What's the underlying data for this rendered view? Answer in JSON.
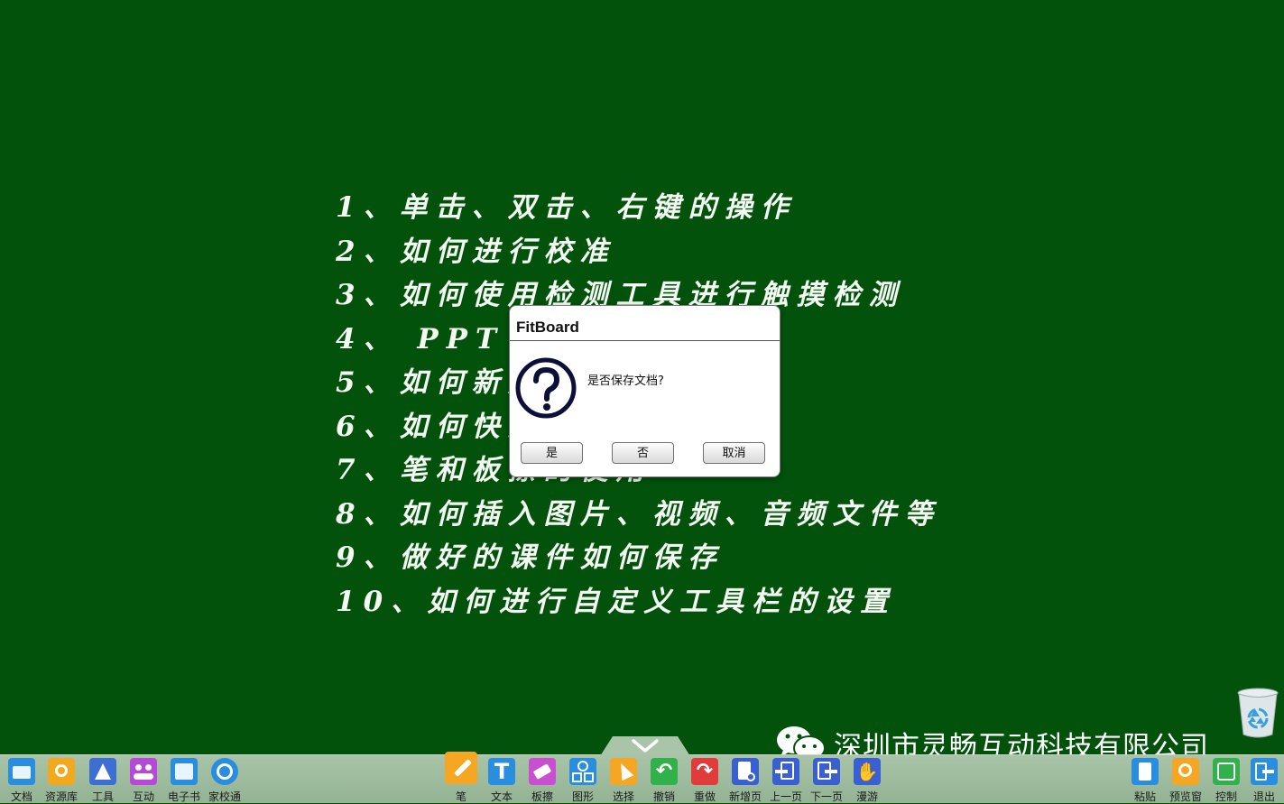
{
  "lesson_items": [
    "1、单击、双击、右键的操作",
    "2、如何进行校准",
    "3、如何使用检测工具进行触摸检测",
    "4、 PPT 模式的使用",
    "5、如何新建页面",
    "6、如何快速清屏",
    "7、笔和板擦的使用",
    "8、如何插入图片、视频、音频文件等",
    "9、做好的课件如何保存",
    "10、如何进行自定义工具栏的设置"
  ],
  "dialog": {
    "title": "FitBoard",
    "message": "是否保存文档?",
    "yes_label": "是",
    "no_label": "否",
    "cancel_label": "取消"
  },
  "watermark": {
    "text": "深圳市灵畅互动科技有限公司"
  },
  "toolbar": {
    "left": [
      {
        "label": "文档",
        "icon": "folder-icon",
        "color": "#2a8ee0"
      },
      {
        "label": "资源库",
        "icon": "resource-library-icon",
        "color": "#f2a91e"
      },
      {
        "label": "工具",
        "icon": "ruler-triangle-icon",
        "color": "#3c6fd1"
      },
      {
        "label": "互动",
        "icon": "people-icon",
        "color": "#b64ad8"
      },
      {
        "label": "电子书",
        "icon": "book-icon",
        "color": "#2a8ee0"
      },
      {
        "label": "家校通",
        "icon": "home-school-icon",
        "color": "#2a8ee0"
      }
    ],
    "center": [
      {
        "label": "笔",
        "icon": "pen-icon",
        "color": "#f5a622"
      },
      {
        "label": "文本",
        "icon": "text-icon",
        "color": "#2a8ee0"
      },
      {
        "label": "板擦",
        "icon": "eraser-icon",
        "color": "#c84fd0"
      },
      {
        "label": "图形",
        "icon": "shapes-icon",
        "color": "#2a8ee0"
      },
      {
        "label": "选择",
        "icon": "cursor-icon",
        "color": "#f5a622"
      },
      {
        "label": "撤销",
        "icon": "undo-icon",
        "color": "#31b14a"
      },
      {
        "label": "重做",
        "icon": "redo-icon",
        "color": "#e23b3b"
      },
      {
        "label": "新增页",
        "icon": "new-page-icon",
        "color": "#3a5fd0"
      },
      {
        "label": "上一页",
        "icon": "prev-page-icon",
        "color": "#3a5fd0"
      },
      {
        "label": "下一页",
        "icon": "next-page-icon",
        "color": "#3a5fd0"
      },
      {
        "label": "漫游",
        "icon": "hand-icon",
        "color": "#3a5fd0"
      }
    ],
    "right": [
      {
        "label": "粘贴",
        "icon": "paste-icon",
        "color": "#2a8ee0"
      },
      {
        "label": "预览窗",
        "icon": "preview-icon",
        "color": "#f5a622"
      },
      {
        "label": "控制",
        "icon": "control-icon",
        "color": "#31b14a"
      },
      {
        "label": "退出",
        "icon": "exit-icon",
        "color": "#2a8ee0"
      }
    ]
  }
}
